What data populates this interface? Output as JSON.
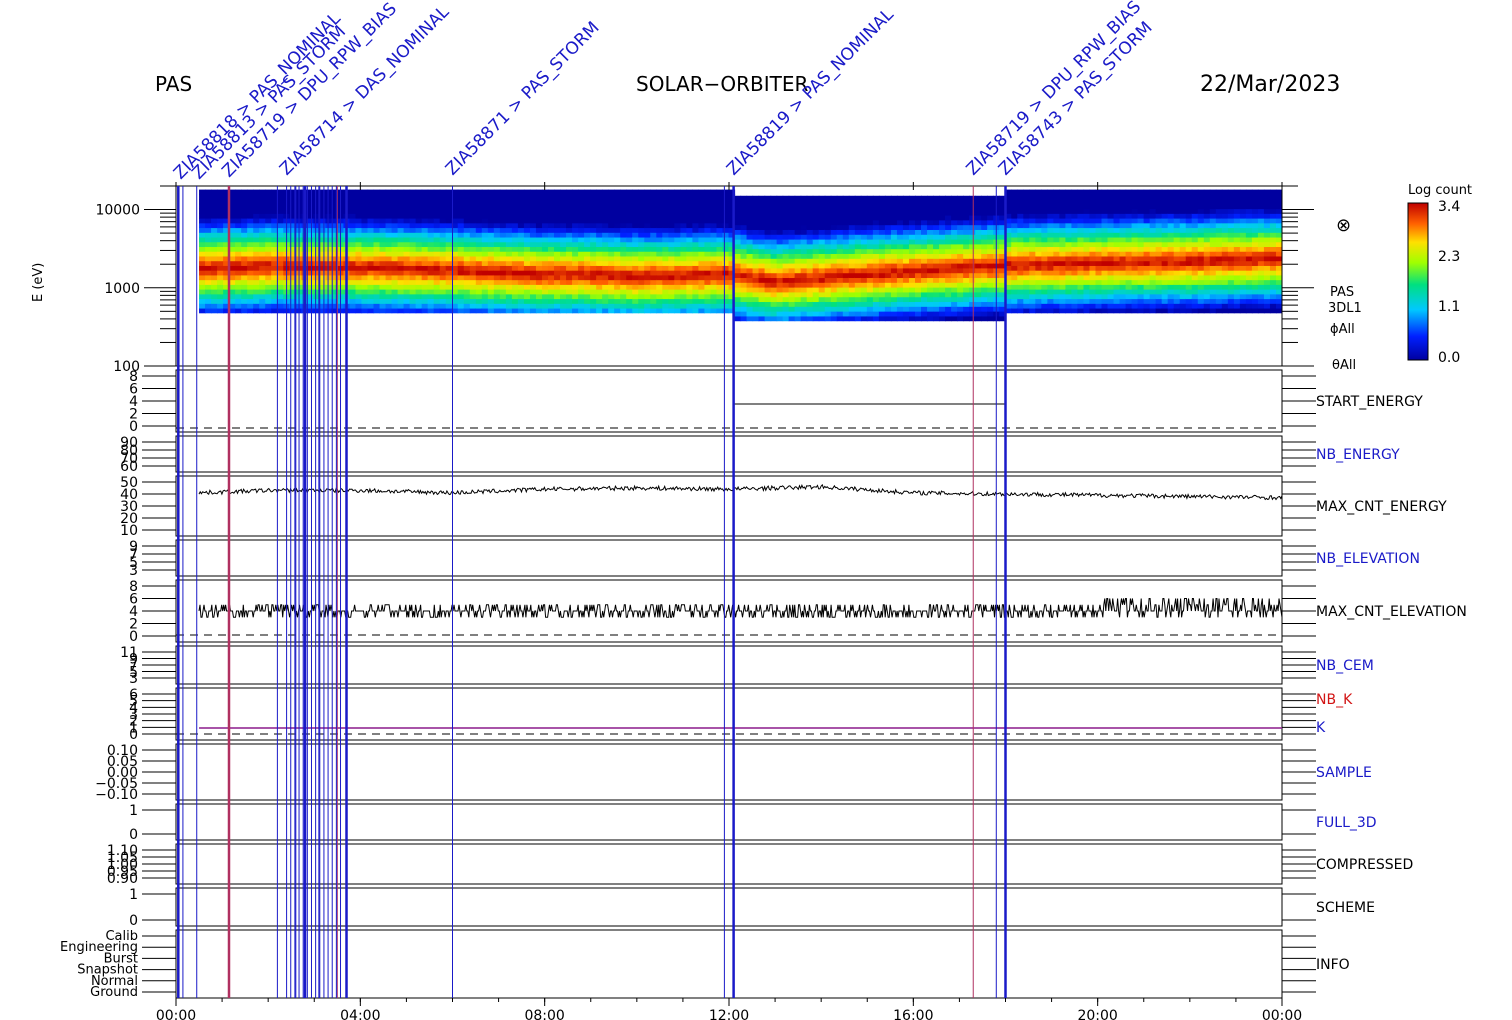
{
  "header": {
    "instrument": "PAS",
    "mission": "SOLAR−ORBITER",
    "date": "22/Mar/2023"
  },
  "time_axis": {
    "tick_labels": [
      "00:00",
      "04:00",
      "08:00",
      "12:00",
      "16:00",
      "20:00",
      "00:00"
    ],
    "tick_hours": [
      0,
      4,
      8,
      12,
      16,
      20,
      24
    ],
    "range_hours": [
      0,
      24
    ]
  },
  "colorbar": {
    "title": "Log count",
    "ticks": [
      "3.4",
      "2.3",
      "1.1",
      "0.0"
    ],
    "tick_values": [
      3.4,
      2.3,
      1.1,
      0.0
    ],
    "range": [
      0.0,
      3.4
    ]
  },
  "spectrogram": {
    "ylabel": "E (eV)",
    "yticks": [
      "10000",
      "1000",
      "100"
    ],
    "ytick_values": [
      10000,
      1000,
      100
    ],
    "ylim": [
      100,
      20000
    ],
    "side_labels": [
      "PAS",
      "3DL1",
      "ϕAll",
      "θAll"
    ],
    "symbol": "⊗"
  },
  "panels": [
    {
      "id": "start_energy",
      "label": "START_ENERGY",
      "color": "#000000",
      "ticks": [
        "8",
        "6",
        "4",
        "2",
        "0"
      ]
    },
    {
      "id": "nb_energy",
      "label": "NB_ENERGY",
      "color": "#1a1ac8",
      "ticks": [
        "90",
        "80",
        "70",
        "60"
      ]
    },
    {
      "id": "max_cnt_energy",
      "label": "MAX_CNT_ENERGY",
      "color": "#000000",
      "ticks": [
        "50",
        "40",
        "30",
        "20",
        "10"
      ]
    },
    {
      "id": "nb_elevation",
      "label": "NB_ELEVATION",
      "color": "#1a1ac8",
      "ticks": [
        "9",
        "7",
        "5",
        "3"
      ]
    },
    {
      "id": "max_cnt_elevation",
      "label": "MAX_CNT_ELEVATION",
      "color": "#000000",
      "ticks": [
        "8",
        "6",
        "4",
        "2",
        "0"
      ]
    },
    {
      "id": "nb_cem",
      "label": "NB_CEM",
      "color": "#1a1ac8",
      "ticks": [
        "11",
        "9",
        "7",
        "5",
        "3"
      ]
    },
    {
      "id": "nb_k_k",
      "label": "NB_K",
      "label2": "K",
      "color": "#d21414",
      "color2": "#1a1ac8",
      "ticks": [
        "6",
        "5",
        "4",
        "3",
        "2",
        "1",
        "0"
      ]
    },
    {
      "id": "sample",
      "label": "SAMPLE",
      "color": "#1a1ac8",
      "ticks": [
        "0.10",
        "0.05",
        "0.00",
        "−0.05",
        "−0.10"
      ]
    },
    {
      "id": "full_3d",
      "label": "FULL_3D",
      "color": "#1a1ac8",
      "ticks": [
        "1",
        "0"
      ]
    },
    {
      "id": "compressed",
      "label": "COMPRESSED",
      "color": "#000000",
      "ticks": [
        "1.10",
        "1.05",
        "1.00",
        "0.95",
        "0.90"
      ]
    },
    {
      "id": "scheme",
      "label": "SCHEME",
      "color": "#000000",
      "ticks": [
        "1",
        "0"
      ]
    },
    {
      "id": "info",
      "label": "INFO",
      "color": "#000000",
      "ticks": [
        "Calib",
        "Engineering",
        "Burst",
        "Snapshot",
        "Normal",
        "Ground"
      ]
    }
  ],
  "event_labels": [
    "ZIA58818 > PAS_NOMINAL",
    "ZIA58813 > PAS_STORM",
    "ZIA58719 > DPU_RPW_BIAS",
    "ZIA58714 > DAS_NOMINAL",
    "ZIA58871 > PAS_STORM",
    "ZIA58819 > PAS_NOMINAL",
    "ZIA58719 > DPU_RPW_BIAS",
    "ZIA58743 > PAS_STORM"
  ],
  "chart_data": {
    "type": "heatmap",
    "title": "",
    "xlabel": "",
    "ylabel": "E (eV)",
    "x_range_hours": [
      0,
      24
    ],
    "y_range_eV": [
      100,
      20000
    ],
    "y_scale": "log",
    "z_label": "Log count",
    "z_range": [
      0.0,
      3.4
    ],
    "peak_energy_eV_by_hour": {
      "hours": [
        0.5,
        2,
        4,
        6,
        8,
        9,
        10,
        12,
        13,
        14,
        16,
        18,
        20,
        22,
        24
      ],
      "values": [
        1800,
        1900,
        1850,
        1700,
        1500,
        1500,
        1400,
        1500,
        1200,
        1350,
        1650,
        1950,
        2100,
        2200,
        2400
      ]
    },
    "max_cnt_energy_by_hour": {
      "hours": [
        0.5,
        2,
        4,
        6,
        8,
        10,
        12,
        14,
        16,
        18,
        20,
        22,
        24
      ],
      "values": [
        41,
        43,
        43,
        41,
        44,
        45,
        44,
        46,
        41,
        40,
        39,
        38,
        37
      ]
    },
    "max_cnt_elevation_typical": 4,
    "nb_k_constant": 1,
    "event_hours": [
      0.05,
      0.15,
      0.45,
      1.15,
      2.2,
      2.6,
      2.8,
      3.1,
      3.5,
      3.7,
      6.0,
      11.9,
      12.1,
      17.3,
      17.8,
      18.0
    ]
  }
}
